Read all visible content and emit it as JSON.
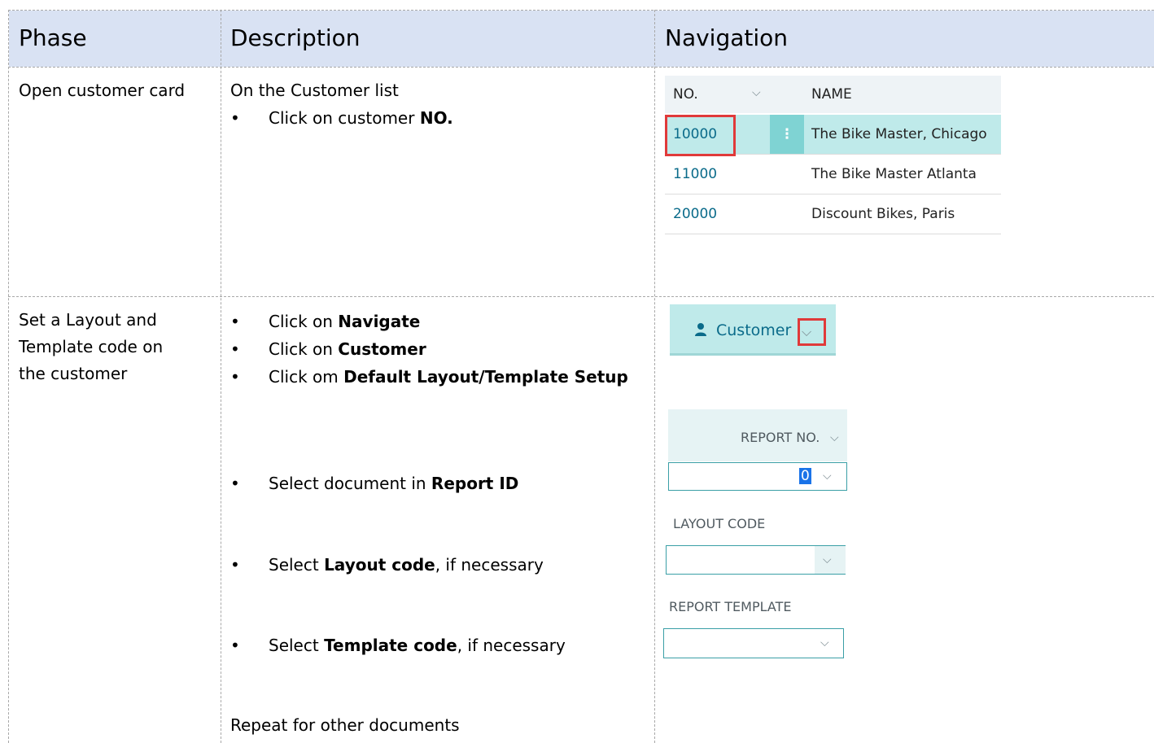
{
  "table": {
    "headers": {
      "phase": "Phase",
      "description": "Description",
      "navigation": "Navigation"
    },
    "row1": {
      "phase": "Open customer card",
      "desc_intro": "On the Customer list",
      "bullet1_pre": "Click on customer ",
      "bullet1_bold": "NO."
    },
    "row2": {
      "phase_line1": "Set a Layout and",
      "phase_line2": "Template code on",
      "phase_line3": "the customer",
      "b1_pre": "Click on ",
      "b1_bold": "Navigate",
      "b2_pre": "Click on ",
      "b2_bold": "Customer",
      "b3_pre": "Click om ",
      "b3_bold": "Default Layout/Template Setup",
      "b4_pre": "Select document in ",
      "b4_bold": "Report ID",
      "b5_pre": "Select ",
      "b5_bold": "Layout code",
      "b5_post": ", if necessary",
      "b6_pre": "Select ",
      "b6_bold": "Template code",
      "b6_post": ", if necessary",
      "repeat": "Repeat for other documents"
    },
    "bullet": "•"
  },
  "customer_list": {
    "col_no": "NO.",
    "col_name": "NAME",
    "rows": [
      {
        "no": "10000",
        "name": "The Bike Master, Chicago"
      },
      {
        "no": "11000",
        "name": "The Bike Master Atlanta"
      },
      {
        "no": "20000",
        "name": "Discount Bikes, Paris"
      }
    ],
    "row_menu": "⋮",
    "chevron": "⌵"
  },
  "customer_button": {
    "label": "Customer",
    "icon": "person-icon"
  },
  "fields": {
    "report_no_label": "REPORT NO.",
    "report_no_value": "0",
    "layout_code_label": "LAYOUT CODE",
    "report_template_label": "REPORT TEMPLATE"
  },
  "colors": {
    "header_bg": "#d9e2f3",
    "accent": "#bfeaea",
    "highlight": "#e03a3a"
  }
}
